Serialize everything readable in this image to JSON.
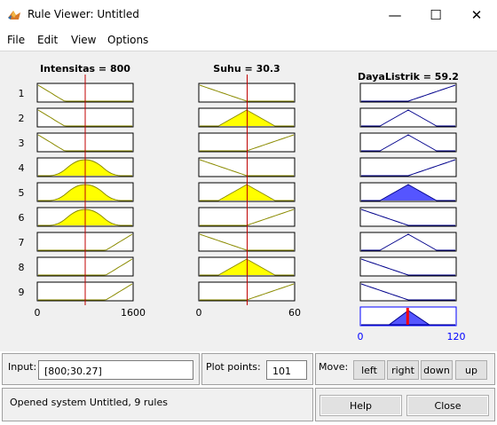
{
  "window": {
    "title": "Rule Viewer: Untitled",
    "minimize_glyph": "—",
    "maximize_glyph": "☐",
    "close_glyph": "✕"
  },
  "menu": [
    "File",
    "Edit",
    "View",
    "Options"
  ],
  "inputs_vars": [
    {
      "header": "Intensitas = 800",
      "range": [
        "0",
        "1600"
      ],
      "line_value": 800,
      "min": 0,
      "max": 1600,
      "rule_mf": [
        "low",
        "low",
        "low",
        "mid",
        "mid",
        "mid",
        "high",
        "high",
        "high"
      ],
      "filled": [
        false,
        false,
        false,
        true,
        true,
        true,
        false,
        false,
        false
      ]
    },
    {
      "header": "Suhu = 30.3",
      "range": [
        "0",
        "60"
      ],
      "line_value": 30.27,
      "min": 0,
      "max": 60,
      "rule_mf": [
        "low",
        "mid",
        "high",
        "low",
        "mid",
        "high",
        "low",
        "mid",
        "high"
      ],
      "filled": [
        false,
        true,
        false,
        false,
        true,
        false,
        false,
        true,
        false
      ]
    }
  ],
  "output_var": {
    "header": "DayaListrik = 59.2",
    "range": [
      "0",
      "120"
    ],
    "min": 0,
    "max": 120,
    "result": 59.2,
    "rule_mf": [
      "high",
      "mid",
      "mid",
      "high",
      "mid",
      "low",
      "mid",
      "low",
      "low"
    ],
    "filled": [
      false,
      false,
      false,
      false,
      true,
      false,
      false,
      false,
      false
    ]
  },
  "rule_numbers": [
    "1",
    "2",
    "3",
    "4",
    "5",
    "6",
    "7",
    "8",
    "9"
  ],
  "colors": {
    "input_line": "#c00000",
    "input_fill": "#ffff00",
    "input_mf_line": "#8b8b00",
    "output_line": "#00008b",
    "output_fill": "#5555ff",
    "output_result_line": "#ff0000",
    "range_blue": "#0000ff"
  },
  "controls": {
    "input_label": "Input:",
    "input_value": "[800;30.27]",
    "plot_points_label": "Plot points:",
    "plot_points_value": "101",
    "move_label": "Move:",
    "move_buttons": [
      "left",
      "right",
      "down",
      "up"
    ],
    "status": "Opened system Untitled, 9 rules",
    "help_label": "Help",
    "close_label": "Close"
  }
}
